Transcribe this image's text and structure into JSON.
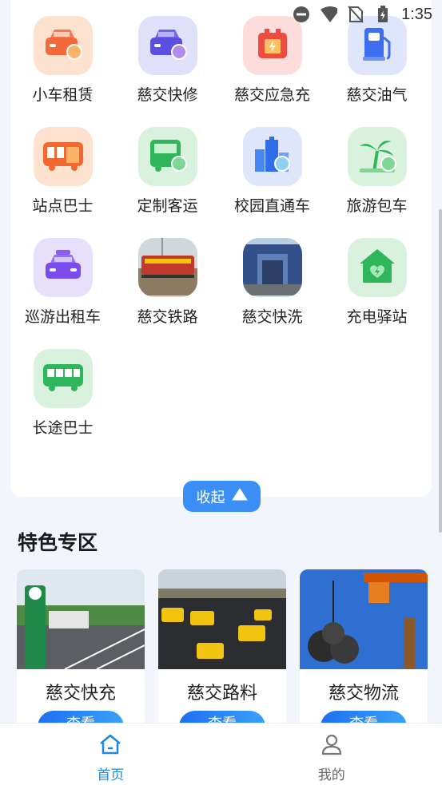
{
  "status_bar": {
    "time": "1:35"
  },
  "grid": [
    {
      "label": "小车租赁",
      "icon": "car-rental-icon",
      "bg": "#fde2cf"
    },
    {
      "label": "慈交快修",
      "icon": "car-repair-icon",
      "bg": "#e1e0fb"
    },
    {
      "label": "慈交应急充",
      "icon": "emergency-charge-icon",
      "bg": "#fddcdc"
    },
    {
      "label": "慈交油气",
      "icon": "fuel-pump-icon",
      "bg": "#dfe6fb"
    },
    {
      "label": "站点巴士",
      "icon": "bus-icon",
      "bg": "#fde2cf"
    },
    {
      "label": "定制客运",
      "icon": "custom-van-icon",
      "bg": "#d9f2de"
    },
    {
      "label": "校园直通车",
      "icon": "campus-bus-icon",
      "bg": "#dfe6fb"
    },
    {
      "label": "旅游包车",
      "icon": "tour-palm-icon",
      "bg": "#d9f2de"
    },
    {
      "label": "巡游出租车",
      "icon": "taxi-icon",
      "bg": "#e8dffb"
    },
    {
      "label": "慈交铁路",
      "icon": "railway-photo",
      "bg": "#d8d0c0"
    },
    {
      "label": "慈交快洗",
      "icon": "car-wash-photo",
      "bg": "#cfd8e2"
    },
    {
      "label": "充电驿站",
      "icon": "charging-station-icon",
      "bg": "#d9f2de"
    },
    {
      "label": "长途巴士",
      "icon": "coach-bus-icon",
      "bg": "#d9f2de"
    }
  ],
  "collapse_label": "收起",
  "section_title": "特色专区",
  "features": [
    {
      "name": "慈交快充",
      "button": "查看"
    },
    {
      "name": "慈交路料",
      "button": "查看"
    },
    {
      "name": "慈交物流",
      "button": "查看"
    }
  ],
  "nav": [
    {
      "label": "首页",
      "active": true
    },
    {
      "label": "我的",
      "active": false
    }
  ],
  "colors": {
    "accent": "#1e88e5",
    "collapse": "#3a8ef5",
    "nav_inactive": "#666666"
  }
}
